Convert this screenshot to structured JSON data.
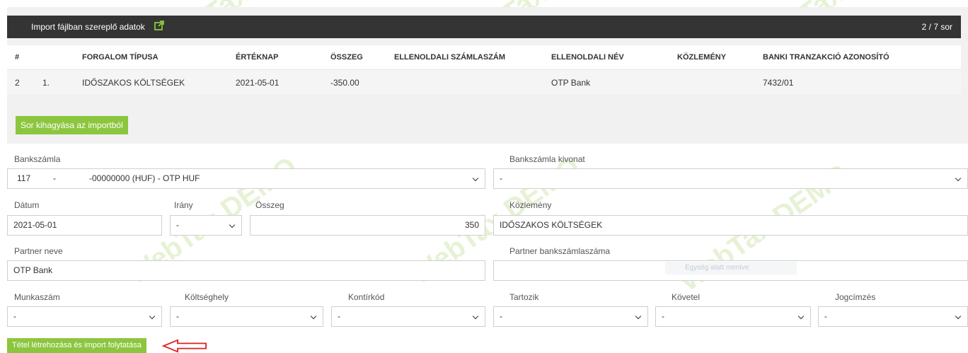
{
  "header": {
    "title": "Import fájlban szereplő adatok",
    "row_counter": "2 / 7 sor"
  },
  "table": {
    "columns": [
      "#",
      "FORGALOM TÍPUSA",
      "ÉRTÉKNAP",
      "ÖSSZEG",
      "ELLENOLDALI SZÁMLASZÁM",
      "ELLENOLDALI NÉV",
      "KÖZLEMÉNY",
      "BANKI TRANZAKCIÓ AZONOSÍTÓ"
    ],
    "row": {
      "index": "2",
      "num": "1.",
      "type": "IDŐSZAKOS KÖLTSÉGEK",
      "date": "2021-05-01",
      "amount": "-350.00",
      "account": "",
      "name": "OTP Bank",
      "memo": "",
      "txid": "7432/01"
    }
  },
  "skip_button": "Sor kihagyása az importból",
  "form": {
    "bank_account": {
      "label": "Bankszámla",
      "value_a": "117",
      "value_b": "-",
      "value_c": "-00000000 (HUF) - OTP HUF"
    },
    "statement": {
      "label": "Bankszámla kivonat",
      "value": "-"
    },
    "date": {
      "label": "Dátum",
      "value": "2021-05-01"
    },
    "direction": {
      "label": "Irány",
      "value": "-"
    },
    "amount": {
      "label": "Összeg",
      "value": "350"
    },
    "memo": {
      "label": "Közlemény",
      "value": "IDŐSZAKOS KÖLTSÉGEK"
    },
    "partner_name": {
      "label": "Partner neve",
      "value": "OTP Bank"
    },
    "partner_account": {
      "label": "Partner bankszámlaszáma",
      "value": ""
    },
    "job_number": {
      "label": "Munkaszám",
      "value": "-"
    },
    "cost_center": {
      "label": "Költséghely",
      "value": "-"
    },
    "contra_code": {
      "label": "Kontírkód",
      "value": "-"
    },
    "debit": {
      "label": "Tartozik",
      "value": "-"
    },
    "credit": {
      "label": "Követel",
      "value": "-"
    },
    "title": {
      "label": "Jogcímzés",
      "value": "-"
    }
  },
  "create_button": "Tétel létrehozása és import folytatása",
  "watermark": "WebTax DEMO",
  "ghost_hint": "Egység alatt mentve",
  "colors": {
    "header_bg": "#343434",
    "accent_green": "#8cc63f",
    "annotation_red": "#e02020"
  },
  "icons": {
    "external_link": "external-link-icon",
    "dropdown": "chevron-down-icon",
    "annotation": "arrow-left-icon"
  }
}
